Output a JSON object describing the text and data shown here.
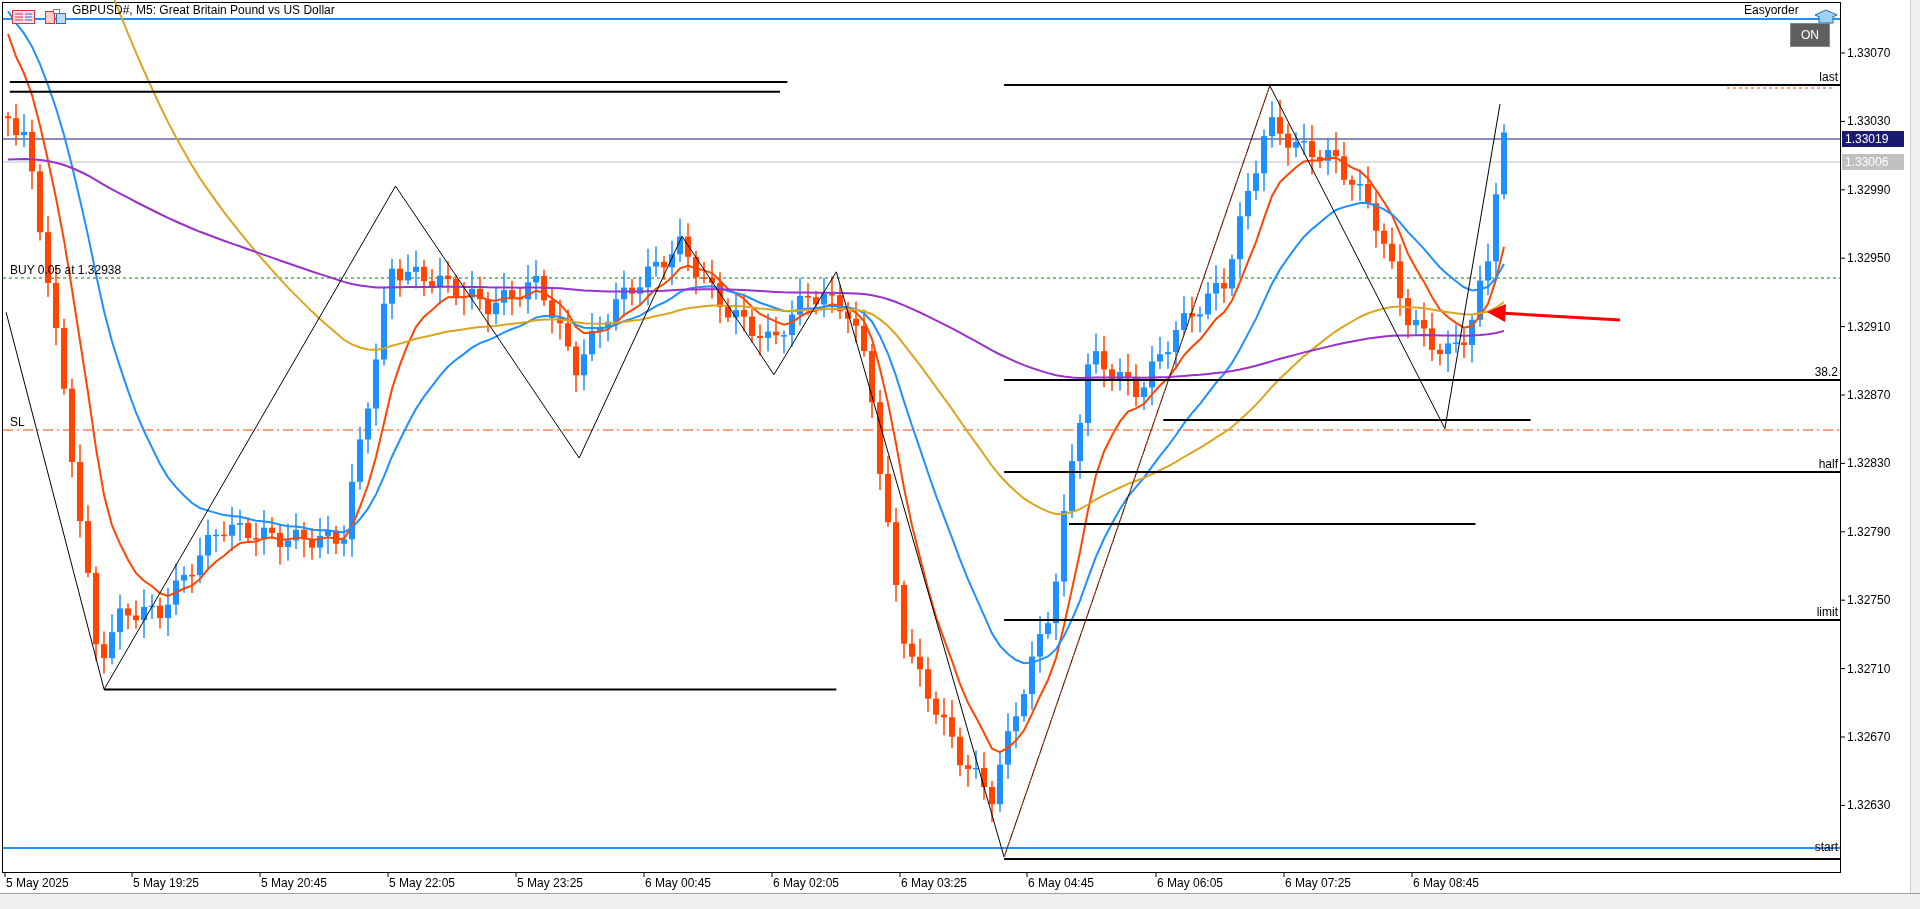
{
  "chart": {
    "title": "GBPUSD#, M5:  Great Britain Pound vs US Dollar",
    "panel": {
      "name": "Easyorder",
      "button": "ON"
    },
    "price_ticks": [
      "1.33070",
      "1.33030",
      "1.32990",
      "1.32950",
      "1.32910",
      "1.32870",
      "1.32830",
      "1.32790",
      "1.32750",
      "1.32710",
      "1.32670",
      "1.32630"
    ],
    "price_badges": [
      {
        "text": "1.33019",
        "color": "#1a1a6e"
      },
      {
        "text": "1.33006",
        "color": "#c0c0c0"
      }
    ],
    "level_labels": [
      "last",
      "38.2",
      "half",
      "limit",
      "start"
    ],
    "order_lines": [
      {
        "label": "BUY 0.05 at 1.32938",
        "kind": "entry"
      },
      {
        "label": "SL",
        "kind": "stop"
      }
    ],
    "time_ticks": [
      "5 May 2025",
      "5 May 19:25",
      "5 May 20:45",
      "5 May 22:05",
      "5 May 23:25",
      "6 May 00:45",
      "6 May 02:05",
      "6 May 03:25",
      "6 May 04:45",
      "6 May 06:05",
      "6 May 07:25",
      "6 May 08:45"
    ]
  }
}
